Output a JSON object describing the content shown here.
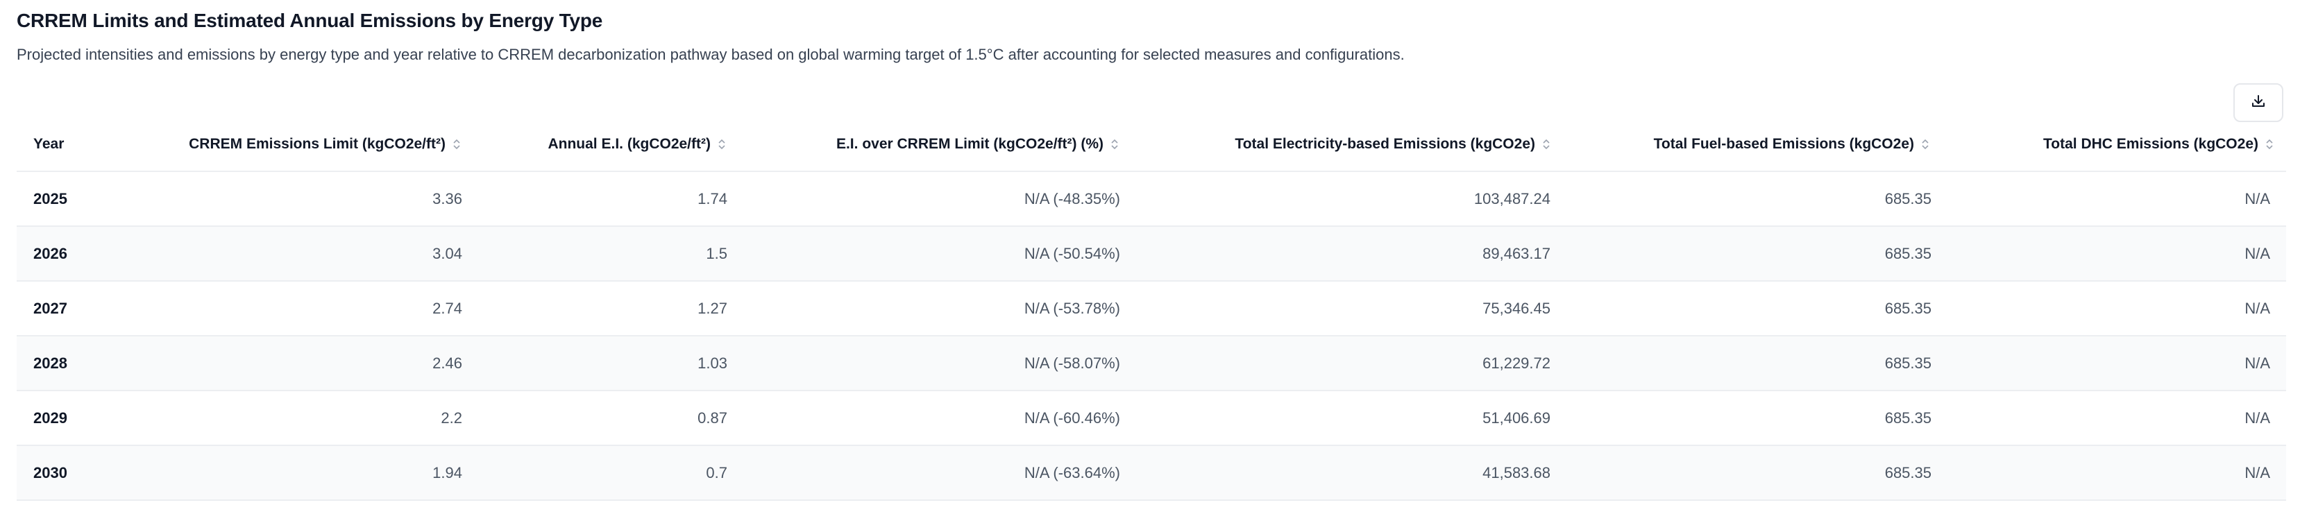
{
  "header": {
    "title": "CRREM Limits and Estimated Annual Emissions by Energy Type",
    "subtitle": "Projected intensities and emissions by energy type and year relative to CRREM decarbonization pathway based on global warming target of 1.5°C after accounting for selected measures and configurations."
  },
  "toolbar": {
    "download_icon": "download-icon"
  },
  "table": {
    "columns": [
      "Year",
      "CRREM Emissions Limit (kgCO2e/ft²)",
      "Annual E.I. (kgCO2e/ft²)",
      "E.I. over CRREM Limit (kgCO2e/ft²) (%)",
      "Total Electricity-based Emissions (kgCO2e)",
      "Total Fuel-based Emissions (kgCO2e)",
      "Total DHC Emissions (kgCO2e)"
    ],
    "rows": [
      [
        "2025",
        "3.36",
        "1.74",
        "N/A (-48.35%)",
        "103,487.24",
        "685.35",
        "N/A"
      ],
      [
        "2026",
        "3.04",
        "1.5",
        "N/A (-50.54%)",
        "89,463.17",
        "685.35",
        "N/A"
      ],
      [
        "2027",
        "2.74",
        "1.27",
        "N/A (-53.78%)",
        "75,346.45",
        "685.35",
        "N/A"
      ],
      [
        "2028",
        "2.46",
        "1.03",
        "N/A (-58.07%)",
        "61,229.72",
        "685.35",
        "N/A"
      ],
      [
        "2029",
        "2.2",
        "0.87",
        "N/A (-60.46%)",
        "51,406.69",
        "685.35",
        "N/A"
      ],
      [
        "2030",
        "1.94",
        "0.7",
        "N/A (-63.64%)",
        "41,583.68",
        "685.35",
        "N/A"
      ]
    ]
  },
  "colors": {
    "row_alt": "#f9fafb",
    "border": "#eceef1",
    "text_muted": "#4b5563"
  }
}
